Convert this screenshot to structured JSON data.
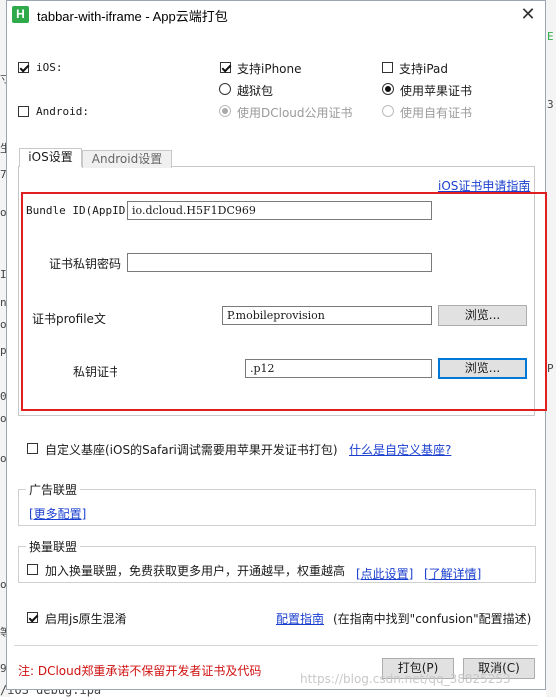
{
  "window": {
    "title": "tabbar-with-iframe - App云端打包",
    "icon_letter": "H",
    "close_glyph": "✕"
  },
  "background_fragments": {
    "left": [
      "寸",
      "生",
      "72",
      "oa",
      "In",
      "n8",
      "oa",
      "pa",
      "06",
      "oa",
      "oa",
      "oa",
      "等",
      "9"
    ],
    "right": [
      "E",
      "3",
      "P"
    ],
    "bottom": "/iOS debug.ipa"
  },
  "platforms": {
    "ios": {
      "label": "iOS:",
      "checked": true
    },
    "android": {
      "label": "Android:",
      "checked": false
    },
    "support_iphone": {
      "label": "支持iPhone",
      "checked": true
    },
    "support_ipad": {
      "label": "支持iPad",
      "checked": false
    },
    "cert_options": [
      {
        "label": "越狱包",
        "selected": false,
        "disabled": false
      },
      {
        "label": "使用苹果证书",
        "selected": true,
        "disabled": false
      },
      {
        "label": "使用DCloud公用证书",
        "selected": true,
        "disabled": true
      },
      {
        "label": "使用自有证书",
        "selected": false,
        "disabled": true
      }
    ]
  },
  "tabs": [
    {
      "label": "iOS设置",
      "active": true
    },
    {
      "label": "Android设置",
      "active": false
    }
  ],
  "ios_settings": {
    "cert_apply_link": "iOS证书申请指南",
    "bundle_id_label": "Bundle ID(AppID)",
    "bundle_id_value": "io.dcloud.H5F1DC969",
    "password_label": "证书私钥密码",
    "password_value": "",
    "profile_label": "证书profile文",
    "profile_value": "P.mobileprovision",
    "key_label": "私钥证书",
    "key_value": ".p12",
    "browse_label": "浏览..."
  },
  "custom_base": {
    "label": "自定义基座(iOS的Safari调试需要用苹果开发证书打包)",
    "checked": false,
    "link": "什么是自定义基座?"
  },
  "ad_alliance": {
    "title": "广告联盟",
    "more_link": "[更多配置]"
  },
  "exchange_alliance": {
    "title": "换量联盟",
    "label": "加入换量联盟，免费获取更多用户，开通越早，权重越高",
    "checked": false,
    "settings_link": "[点此设置]",
    "details_link": "[了解详情]"
  },
  "obfuscation": {
    "label": "启用js原生混淆",
    "checked": true,
    "guide_link": "配置指南",
    "guide_note": "(在指南中找到\"confusion\"配置描述)"
  },
  "footer": {
    "warning": "注: DCloud郑重承诺不保留开发者证书及代码",
    "pack_button": "打包(P)",
    "cancel_button": "取消(C)",
    "watermark": "https://blog.csdn.net/qq_38825253"
  },
  "colors": {
    "highlight_box": "#e02020",
    "link": "#1a3fcf",
    "warning_text": "#d01010",
    "focus_border": "#0078d7"
  }
}
